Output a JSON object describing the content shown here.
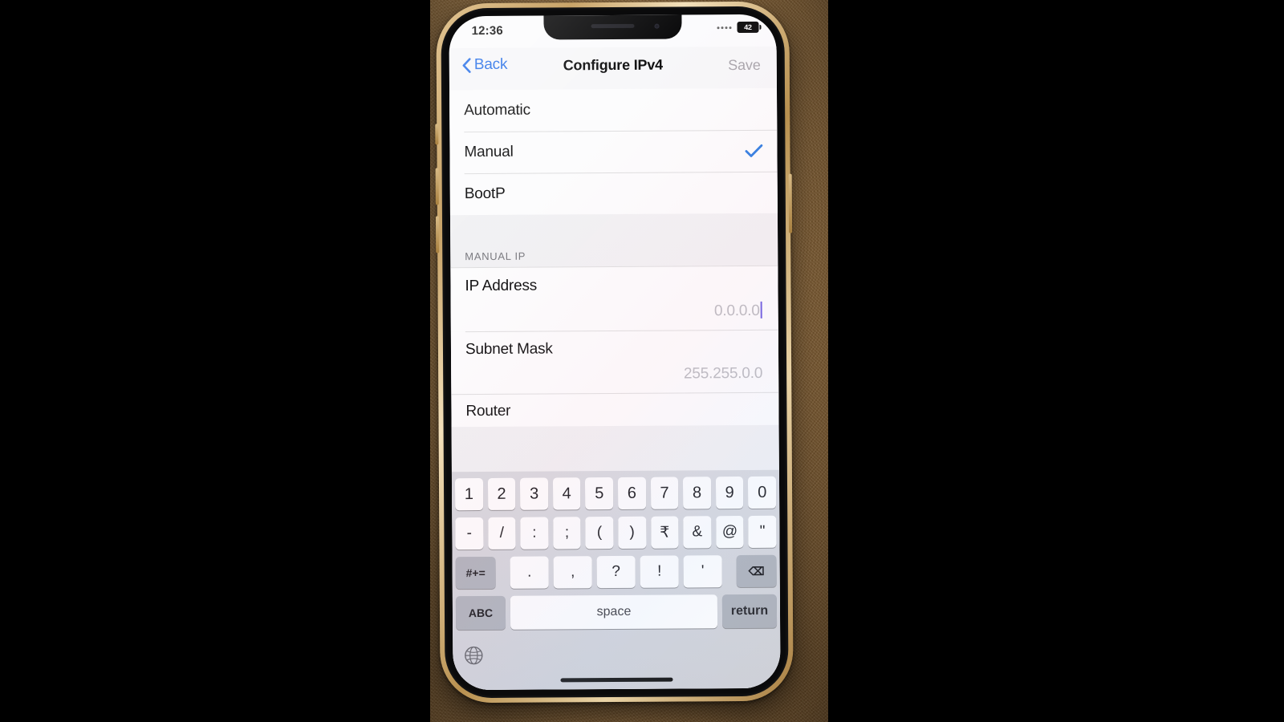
{
  "status_bar": {
    "time": "12:36",
    "battery_percent": "42",
    "signal_dots": 4
  },
  "nav_bar": {
    "back_label": "Back",
    "title": "Configure IPv4",
    "save_label": "Save",
    "back_color": "#2b72e8",
    "save_color": "#a9a6ac"
  },
  "config_options": [
    {
      "label": "Automatic",
      "selected": false
    },
    {
      "label": "Manual",
      "selected": true
    },
    {
      "label": "BootP",
      "selected": false
    }
  ],
  "manual_section": {
    "header": "MANUAL IP",
    "fields": [
      {
        "label": "IP Address",
        "value": "0.0.0.0",
        "focused": true
      },
      {
        "label": "Subnet Mask",
        "value": "255.255.0.0",
        "focused": false
      },
      {
        "label": "Router",
        "value": "",
        "focused": false
      }
    ]
  },
  "keyboard": {
    "row1": [
      "1",
      "2",
      "3",
      "4",
      "5",
      "6",
      "7",
      "8",
      "9",
      "0"
    ],
    "row2": [
      "-",
      "/",
      ":",
      ";",
      "(",
      ")",
      "₹",
      "&",
      "@",
      "\""
    ],
    "row3_symbols": [
      "#+=",
      ".",
      ",",
      "?",
      "!",
      "'"
    ],
    "row3_delete": "⌫",
    "row4": {
      "abc": "ABC",
      "space": "space",
      "return": "return"
    },
    "globe": "globe-icon"
  },
  "theme": {
    "accent_blue": "#2b72e8",
    "checkmark_blue": "#2f7de1",
    "caret_purple": "#6a5ae0",
    "list_bg": "#fcfcfd",
    "group_bg": "#f2f2f4",
    "separator": "#dededf",
    "phone_frame_gold": "#c9a469",
    "background_tan": "#b0834a"
  }
}
